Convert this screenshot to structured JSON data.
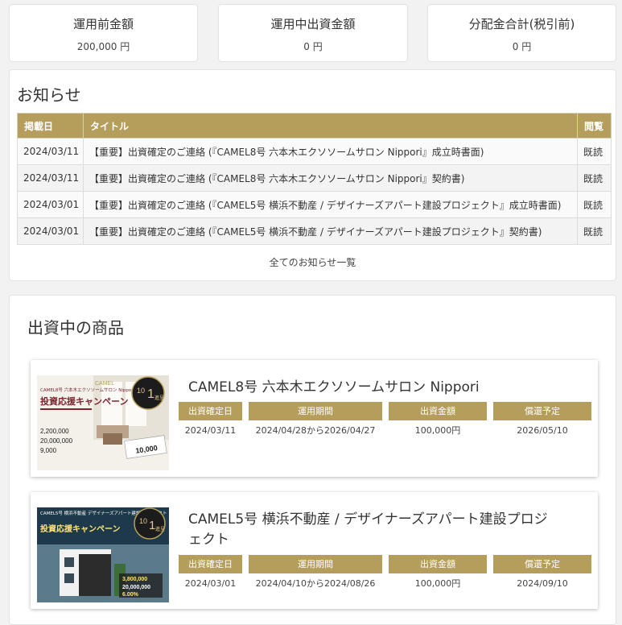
{
  "summary": [
    {
      "label": "運用前金額",
      "value": "200,000 円"
    },
    {
      "label": "運用中出資金額",
      "value": "0 円"
    },
    {
      "label": "分配金合計(税引前)",
      "value": "0 円"
    }
  ],
  "news": {
    "title": "お知らせ",
    "headers": {
      "date": "掲載日",
      "title": "タイトル",
      "read": "閲覧"
    },
    "rows": [
      {
        "date": "2024/03/11",
        "title": "【重要】出資確定のご連絡 (『CAMEL8号 六本木エクソソームサロン Nippori』成立時書面)",
        "read": "既読"
      },
      {
        "date": "2024/03/11",
        "title": "【重要】出資確定のご連絡 (『CAMEL8号 六本木エクソソームサロン Nippori』契約書)",
        "read": "既読"
      },
      {
        "date": "2024/03/01",
        "title": "【重要】出資確定のご連絡 (『CAMEL5号 横浜不動産 / デザイナーズアパート建設プロジェクト』成立時書面)",
        "read": "既読"
      },
      {
        "date": "2024/03/01",
        "title": "【重要】出資確定のご連絡 (『CAMEL5号 横浜不動産 / デザイナーズアパート建設プロジェクト』契約書)",
        "read": "既読"
      }
    ],
    "all_link": "全てのお知らせ一覧"
  },
  "products": {
    "title": "出資中の商品",
    "headers": {
      "confirmed": "出資確定日",
      "period": "運用期間",
      "amount": "出資金額",
      "redemption": "償還予定"
    },
    "items": [
      {
        "name": "CAMEL8号 六本木エクソソームサロン Nippori",
        "confirmed": "2024/03/11",
        "period": "2024/04/28から2026/04/27",
        "amount": "100,000円",
        "redemption": "2026/05/10",
        "banner": {
          "brand": "CAMEL",
          "headline": "投資応援キャンペーン",
          "sub": "CAMEL8号 六本木エクソソームサロン Nippori",
          "amounts": [
            "2,200,000",
            "20,000,000",
            "9,000"
          ],
          "badge_top": "10",
          "badge_main": "1",
          "badge_text": "進呈",
          "voucher": "10,000",
          "colors": {
            "bg": "#f4f1ea",
            "title": "#7a2530",
            "accent": "#1c1c1c"
          }
        }
      },
      {
        "name": "CAMEL5号 横浜不動産 / デザイナーズアパート建設プロジェクト",
        "confirmed": "2024/03/01",
        "period": "2024/04/10から2024/08/26",
        "amount": "100,000円",
        "redemption": "2024/09/10",
        "banner": {
          "brand": "CAMEL",
          "headline": "投資応援キャンペーン",
          "sub": "CAMEL5号 横浜不動産 デザイナーズアパート建設プロジェクト",
          "amounts": [
            "3,800,000",
            "20,000,000",
            "6.00%"
          ],
          "badge_top": "10",
          "badge_main": "1",
          "badge_text": "進呈",
          "colors": {
            "bg": "#1e3a4a",
            "title": "#ffe27a",
            "accent": "#ffffff"
          }
        }
      }
    ]
  },
  "colors": {
    "accent": "#b59d5b",
    "background": "#f2f2f2"
  }
}
